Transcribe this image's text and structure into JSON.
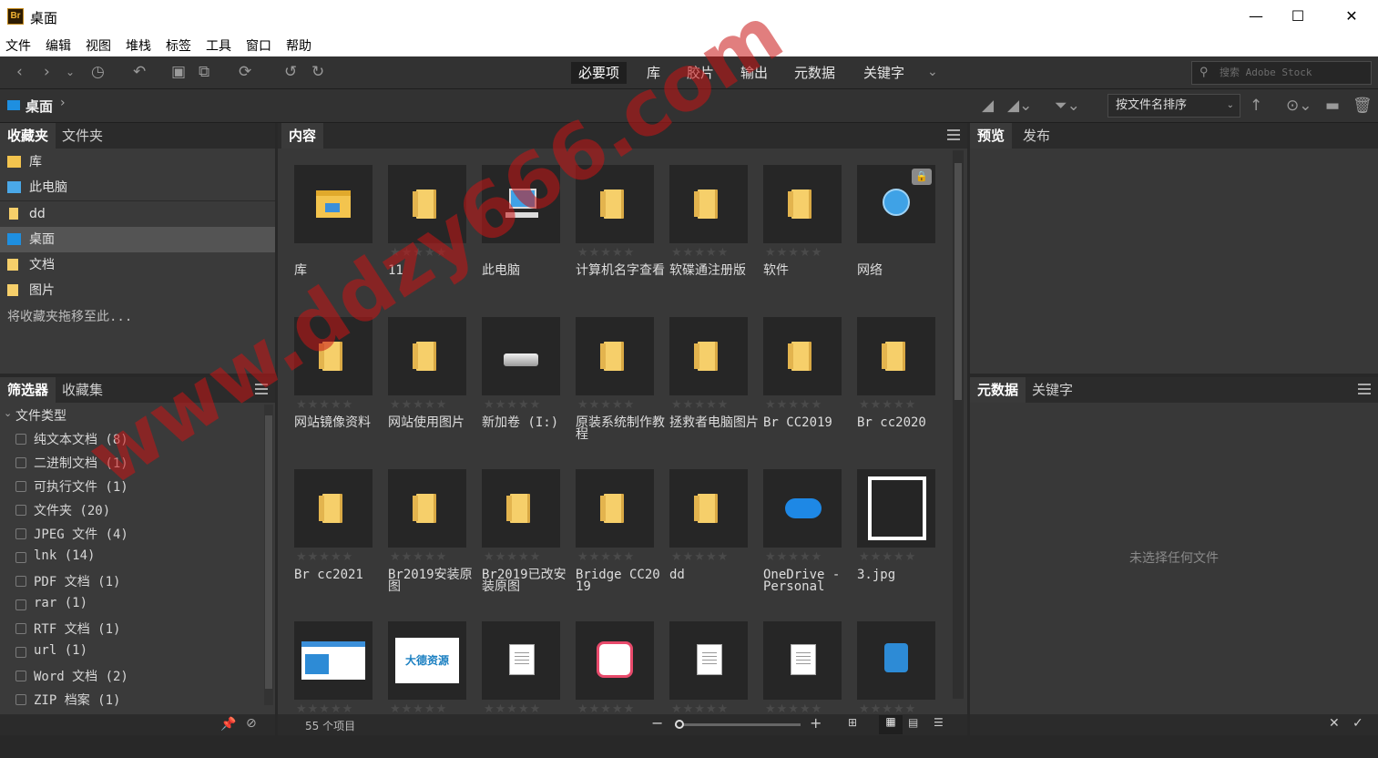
{
  "window": {
    "title": "桌面",
    "logo_text": "Br",
    "minimize": "—",
    "maximize": "☐",
    "close": "✕"
  },
  "menu": [
    "文件",
    "编辑",
    "视图",
    "堆栈",
    "标签",
    "工具",
    "窗口",
    "帮助"
  ],
  "workspaces": [
    "必要项",
    "库",
    "胶片",
    "输出",
    "元数据",
    "关键字"
  ],
  "active_workspace": "必要项",
  "search": {
    "placeholder": "搜索 Adobe Stock"
  },
  "path": {
    "current": "桌面",
    "chevron": "›"
  },
  "sort": {
    "label": "按文件名排序"
  },
  "favorites_panel": {
    "tabs": [
      "收藏夹",
      "文件夹"
    ],
    "items": [
      {
        "label": "库",
        "icon": "library-icon"
      },
      {
        "label": "此电脑",
        "icon": "computer-icon"
      },
      {
        "label": "dd",
        "icon": "folder-icon"
      },
      {
        "label": "桌面",
        "icon": "desktop-icon",
        "selected": true
      },
      {
        "label": "文档",
        "icon": "documents-icon"
      },
      {
        "label": "图片",
        "icon": "pictures-icon"
      }
    ],
    "hint": "将收藏夹拖移至此..."
  },
  "filter_panel": {
    "tabs": [
      "筛选器",
      "收藏集"
    ],
    "group": "文件类型",
    "items": [
      "纯文本文档 (8)",
      "二进制文档 (1)",
      "可执行文件 (1)",
      "文件夹 (20)",
      "JPEG 文件 (4)",
      "lnk (14)",
      "PDF 文档 (1)",
      "rar (1)",
      "RTF 文档 (1)",
      "url (1)",
      "Word 文档 (2)",
      "ZIP 档案 (1)"
    ]
  },
  "content_panel": {
    "tab": "内容",
    "stars": "★★★★★",
    "items": [
      {
        "name": "库",
        "kind": "library"
      },
      {
        "name": "11",
        "kind": "folder"
      },
      {
        "name": "此电脑",
        "kind": "pc"
      },
      {
        "name": "计算机名字查看",
        "kind": "folder"
      },
      {
        "name": "软碟通注册版",
        "kind": "folder"
      },
      {
        "name": "软件",
        "kind": "folder"
      },
      {
        "name": "网络",
        "kind": "network",
        "locked": true
      },
      {
        "name": "网站镜像资料",
        "kind": "folder"
      },
      {
        "name": "网站使用图片",
        "kind": "folder"
      },
      {
        "name": "新加卷 (I:)",
        "kind": "drive"
      },
      {
        "name": "原装系统制作教程",
        "kind": "folder"
      },
      {
        "name": "拯救者电脑图片",
        "kind": "folder"
      },
      {
        "name": "Br CC2019",
        "kind": "folder"
      },
      {
        "name": "Br cc2020",
        "kind": "folder"
      },
      {
        "name": "Br cc2021",
        "kind": "folder"
      },
      {
        "name": "Br2019安装原图",
        "kind": "folder"
      },
      {
        "name": "Br2019已改安装原图",
        "kind": "folder"
      },
      {
        "name": "Bridge CC2019",
        "kind": "folder"
      },
      {
        "name": "dd",
        "kind": "folder"
      },
      {
        "name": "OneDrive - Personal",
        "kind": "onedrive"
      },
      {
        "name": "3.jpg",
        "kind": "qr"
      },
      {
        "name": "",
        "kind": "screenshot"
      },
      {
        "name": "",
        "kind": "logo"
      },
      {
        "name": "",
        "kind": "doc"
      },
      {
        "name": "",
        "kind": "app"
      },
      {
        "name": "",
        "kind": "doc"
      },
      {
        "name": "",
        "kind": "doc"
      },
      {
        "name": "",
        "kind": "shortcut"
      }
    ],
    "logo_text": "大德资源"
  },
  "preview_panel": {
    "tabs": [
      "预览",
      "发布"
    ]
  },
  "metadata_panel": {
    "tabs": [
      "元数据",
      "关键字"
    ],
    "empty": "未选择任何文件"
  },
  "status": {
    "count": "55 个项目"
  },
  "watermark": "www.ddzy666.com",
  "colors": {
    "accent": "#1e8fe0",
    "folder": "#f6cf6a",
    "watermark": "#c81414"
  }
}
